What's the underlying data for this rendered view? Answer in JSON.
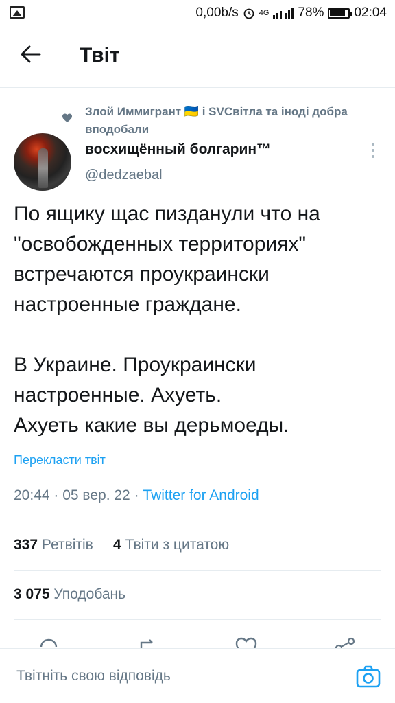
{
  "status_bar": {
    "network_speed": "0,00b/s",
    "network_type": "4G",
    "battery": "78%",
    "battery_level": 0.78,
    "time": "02:04",
    "icons": [
      "gallery-icon",
      "alarm-icon",
      "signal-icon",
      "battery-icon"
    ]
  },
  "header": {
    "title": "Твіт",
    "back_icon": "arrow-left-icon"
  },
  "social_context": {
    "text": "Злой Иммигрант 🇺🇦 і SVСвітла та іноді добра вподобали",
    "icon": "heart-icon"
  },
  "author": {
    "display_name": "восхищённый болгарин™",
    "handle": "@dedzaebal"
  },
  "tweet": {
    "lines": [
      "По ящику щас пизданули что на",
      "\"освобожденных территориях\"",
      "встречаются проукраински",
      "настроенные граждане.",
      "",
      "В Украине. Проукраински",
      "настроенные. Ахуеть.",
      "Ахуеть какие вы дерьмоеды."
    ],
    "translate_label": "Перекласти твіт",
    "time": "20:44",
    "date": "05 вер. 22",
    "source": "Twitter for Android"
  },
  "stats": {
    "retweets_count": "337",
    "retweets_label": "Ретвітів",
    "quotes_count": "4",
    "quotes_label": "Твіти з цитатою",
    "likes_count": "3 075",
    "likes_label": "Уподобань"
  },
  "reply": {
    "placeholder": "Твітніть свою відповідь",
    "camera_icon": "camera-icon"
  },
  "colors": {
    "accent": "#1da1f2",
    "secondary_text": "#657786",
    "primary_text": "#14171a"
  }
}
